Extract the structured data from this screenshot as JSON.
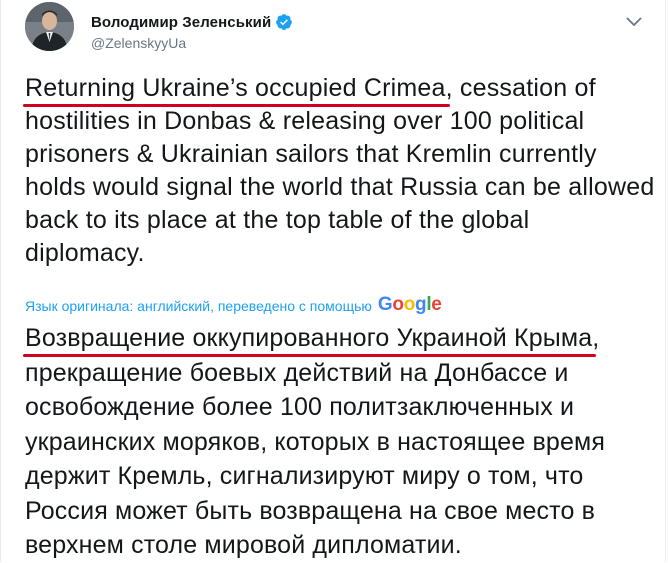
{
  "author": {
    "display_name": "Володимир Зеленський",
    "handle": "@ZelenskyyUa",
    "verified": true,
    "avatar_icon": "profile-photo-avatar"
  },
  "menu_icon": "chevron-down-icon",
  "tweet": {
    "highlighted_phrase": "Returning Ukraine’s occupied Crimea",
    "rest": ", cessation of hostilities in Donbas & releasing over 100 political prisoners & Ukrainian sailors that Kremlin currently holds would signal the world that Russia can be allowed back to its place at the top table of the global diplomacy."
  },
  "translation": {
    "meta_label": "Язык оригинала: английский, переведено с помощью",
    "provider": "Google",
    "highlighted_phrase": "Возвращение оккупированного Украиной Крыма",
    "rest": ", прекращение боевых действий на Донбассе и освобождение более 100 политзаключенных и украинских моряков, которых в настоящее время держит Кремль, сигнализируют миру о том, что Россия может быть возвращена на свое место в верхнем столе мировой дипломатии."
  },
  "colors": {
    "link_blue": "#1da1f2",
    "verified_blue": "#1da1f2",
    "underline_red": "#d0021b",
    "handle_gray": "#657786"
  }
}
